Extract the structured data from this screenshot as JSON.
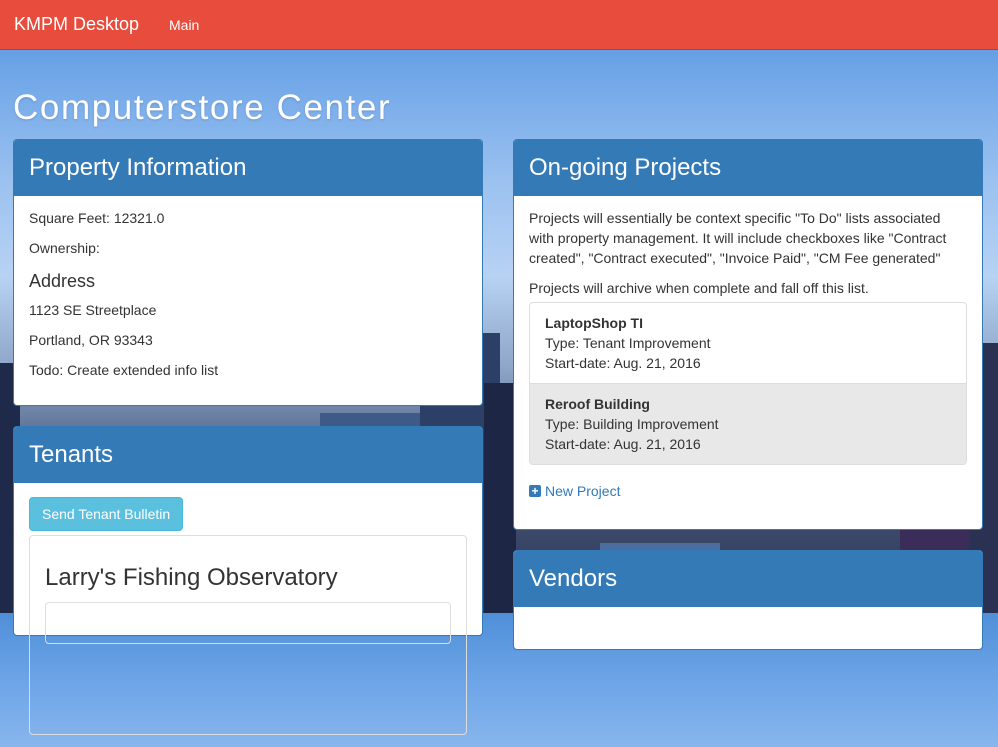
{
  "navbar": {
    "brand": "KMPM Desktop",
    "main_link": "Main"
  },
  "page_title": "Computerstore Center",
  "property": {
    "heading": "Property Information",
    "square_feet": "Square Feet: 12321.0",
    "ownership": "Ownership:",
    "address_heading": "Address",
    "street": "1123 SE Streetplace",
    "city_state": "Portland, OR 93343",
    "todo": "Todo: Create extended info list"
  },
  "tenants": {
    "heading": "Tenants",
    "bulletin_button": "Send Tenant Bulletin",
    "first_tenant": "Larry's Fishing Observatory"
  },
  "projects": {
    "heading": "On-going Projects",
    "description": "Projects will essentially be context specific \"To Do\" lists associated with property management. It will include checkboxes like \"Contract created\", \"Contract executed\", \"Invoice Paid\", \"CM Fee generated\"",
    "archive_note": "Projects will archive when complete and fall off this list.",
    "items": [
      {
        "name": "LaptopShop TI",
        "type": "Type: Tenant Improvement",
        "start": "Start-date: Aug. 21, 2016"
      },
      {
        "name": "Reroof Building",
        "type": "Type: Building Improvement",
        "start": "Start-date: Aug. 21, 2016"
      }
    ],
    "new_project": "New Project"
  },
  "vendors": {
    "heading": "Vendors"
  },
  "colors": {
    "navbar": "#e74c3c",
    "panel_header": "#337ab7",
    "info_button": "#5bc0de"
  },
  "icons": {
    "new_project": "plus-square-icon"
  }
}
